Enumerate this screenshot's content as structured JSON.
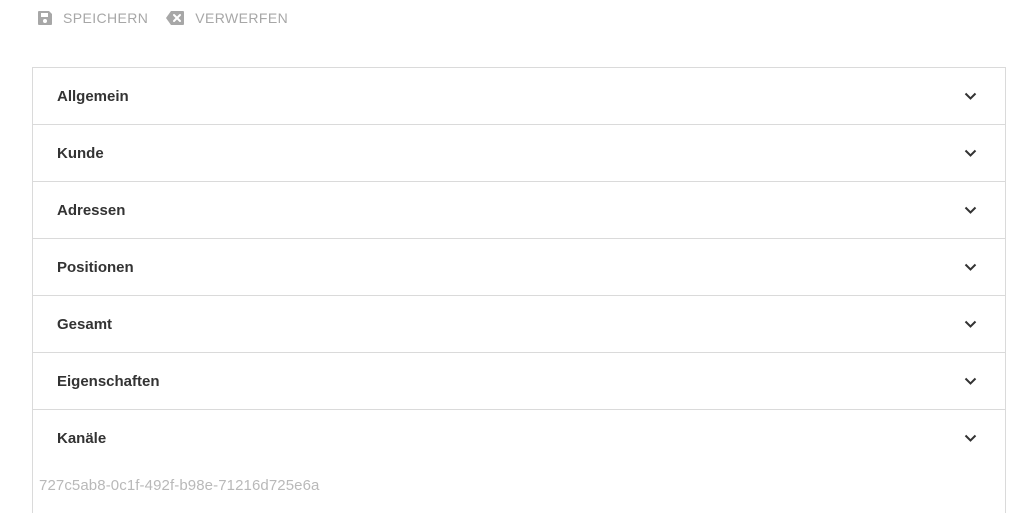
{
  "toolbar": {
    "save": {
      "label": "SPEICHERN",
      "icon": "save-icon"
    },
    "discard": {
      "label": "VERWERFEN",
      "icon": "discard-icon"
    }
  },
  "sections": [
    {
      "label": "Allgemein"
    },
    {
      "label": "Kunde"
    },
    {
      "label": "Adressen"
    },
    {
      "label": "Positionen"
    },
    {
      "label": "Gesamt"
    },
    {
      "label": "Eigenschaften"
    },
    {
      "label": "Kanäle"
    }
  ],
  "footer": {
    "uuid": "727c5ab8-0c1f-492f-b98e-71216d725e6a"
  },
  "colors": {
    "toolbar_text": "#a7a7a7",
    "section_text": "#333333",
    "border": "#dadada",
    "muted_text": "#b9b9b9"
  }
}
